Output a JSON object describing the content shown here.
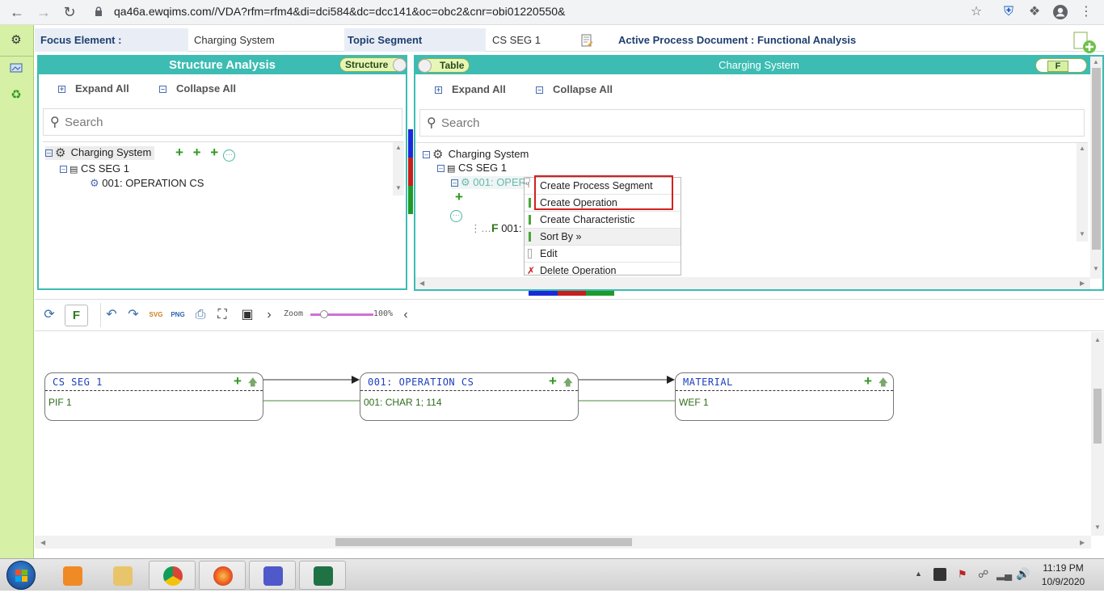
{
  "browser": {
    "url": "qa46a.ewqims.com//VDA?rfm=rfm4&di=dci584&dc=dcc141&oc=obc2&cnr=obi01220550&"
  },
  "header": {
    "focus_label": "Focus Element :",
    "focus_value": "Charging System",
    "topic_label": "Topic Segment",
    "topic_value": "CS SEG 1",
    "active_doc": "Active Process Document : Functional Analysis"
  },
  "left_panel": {
    "title": "Structure Analysis",
    "toggle_label": "Structure",
    "expand_all": "Expand All",
    "collapse_all": "Collapse All",
    "search_placeholder": "Search",
    "tree": {
      "root": "Charging System",
      "seg": "CS SEG 1",
      "op": "001: OPERATION CS"
    }
  },
  "right_panel": {
    "title": "Charging System",
    "toggle_label": "Table",
    "toggle_f": "F",
    "expand_all": "Expand All",
    "collapse_all": "Collapse All",
    "search_placeholder": "Search",
    "tree": {
      "root": "Charging System",
      "seg": "CS SEG 1",
      "op": "001: OPER",
      "char_prefix": "F",
      "char": "001: CH"
    }
  },
  "context_menu": {
    "items": [
      "Create Process Segment",
      "Create Operation",
      "Create Characteristic",
      "Sort By »",
      "Edit",
      "Delete Operation"
    ]
  },
  "toolbar": {
    "f_label": "F",
    "zoom_label": "Zoom",
    "zoom_value": "100%",
    "zoom_level": 100
  },
  "diagram": {
    "nodes": [
      {
        "title": "CS SEG 1",
        "value": "PIF 1"
      },
      {
        "title": "001: OPERATION CS",
        "value": "001: CHAR 1; 114"
      },
      {
        "title": "MATERIAL",
        "value": "WEF 1"
      }
    ]
  },
  "taskbar": {
    "time": "11:19 PM",
    "date": "10/9/2020"
  },
  "colors": {
    "accent": "#3cbcb2",
    "rail": "#d6f0a6",
    "highlight": "#d42020"
  }
}
